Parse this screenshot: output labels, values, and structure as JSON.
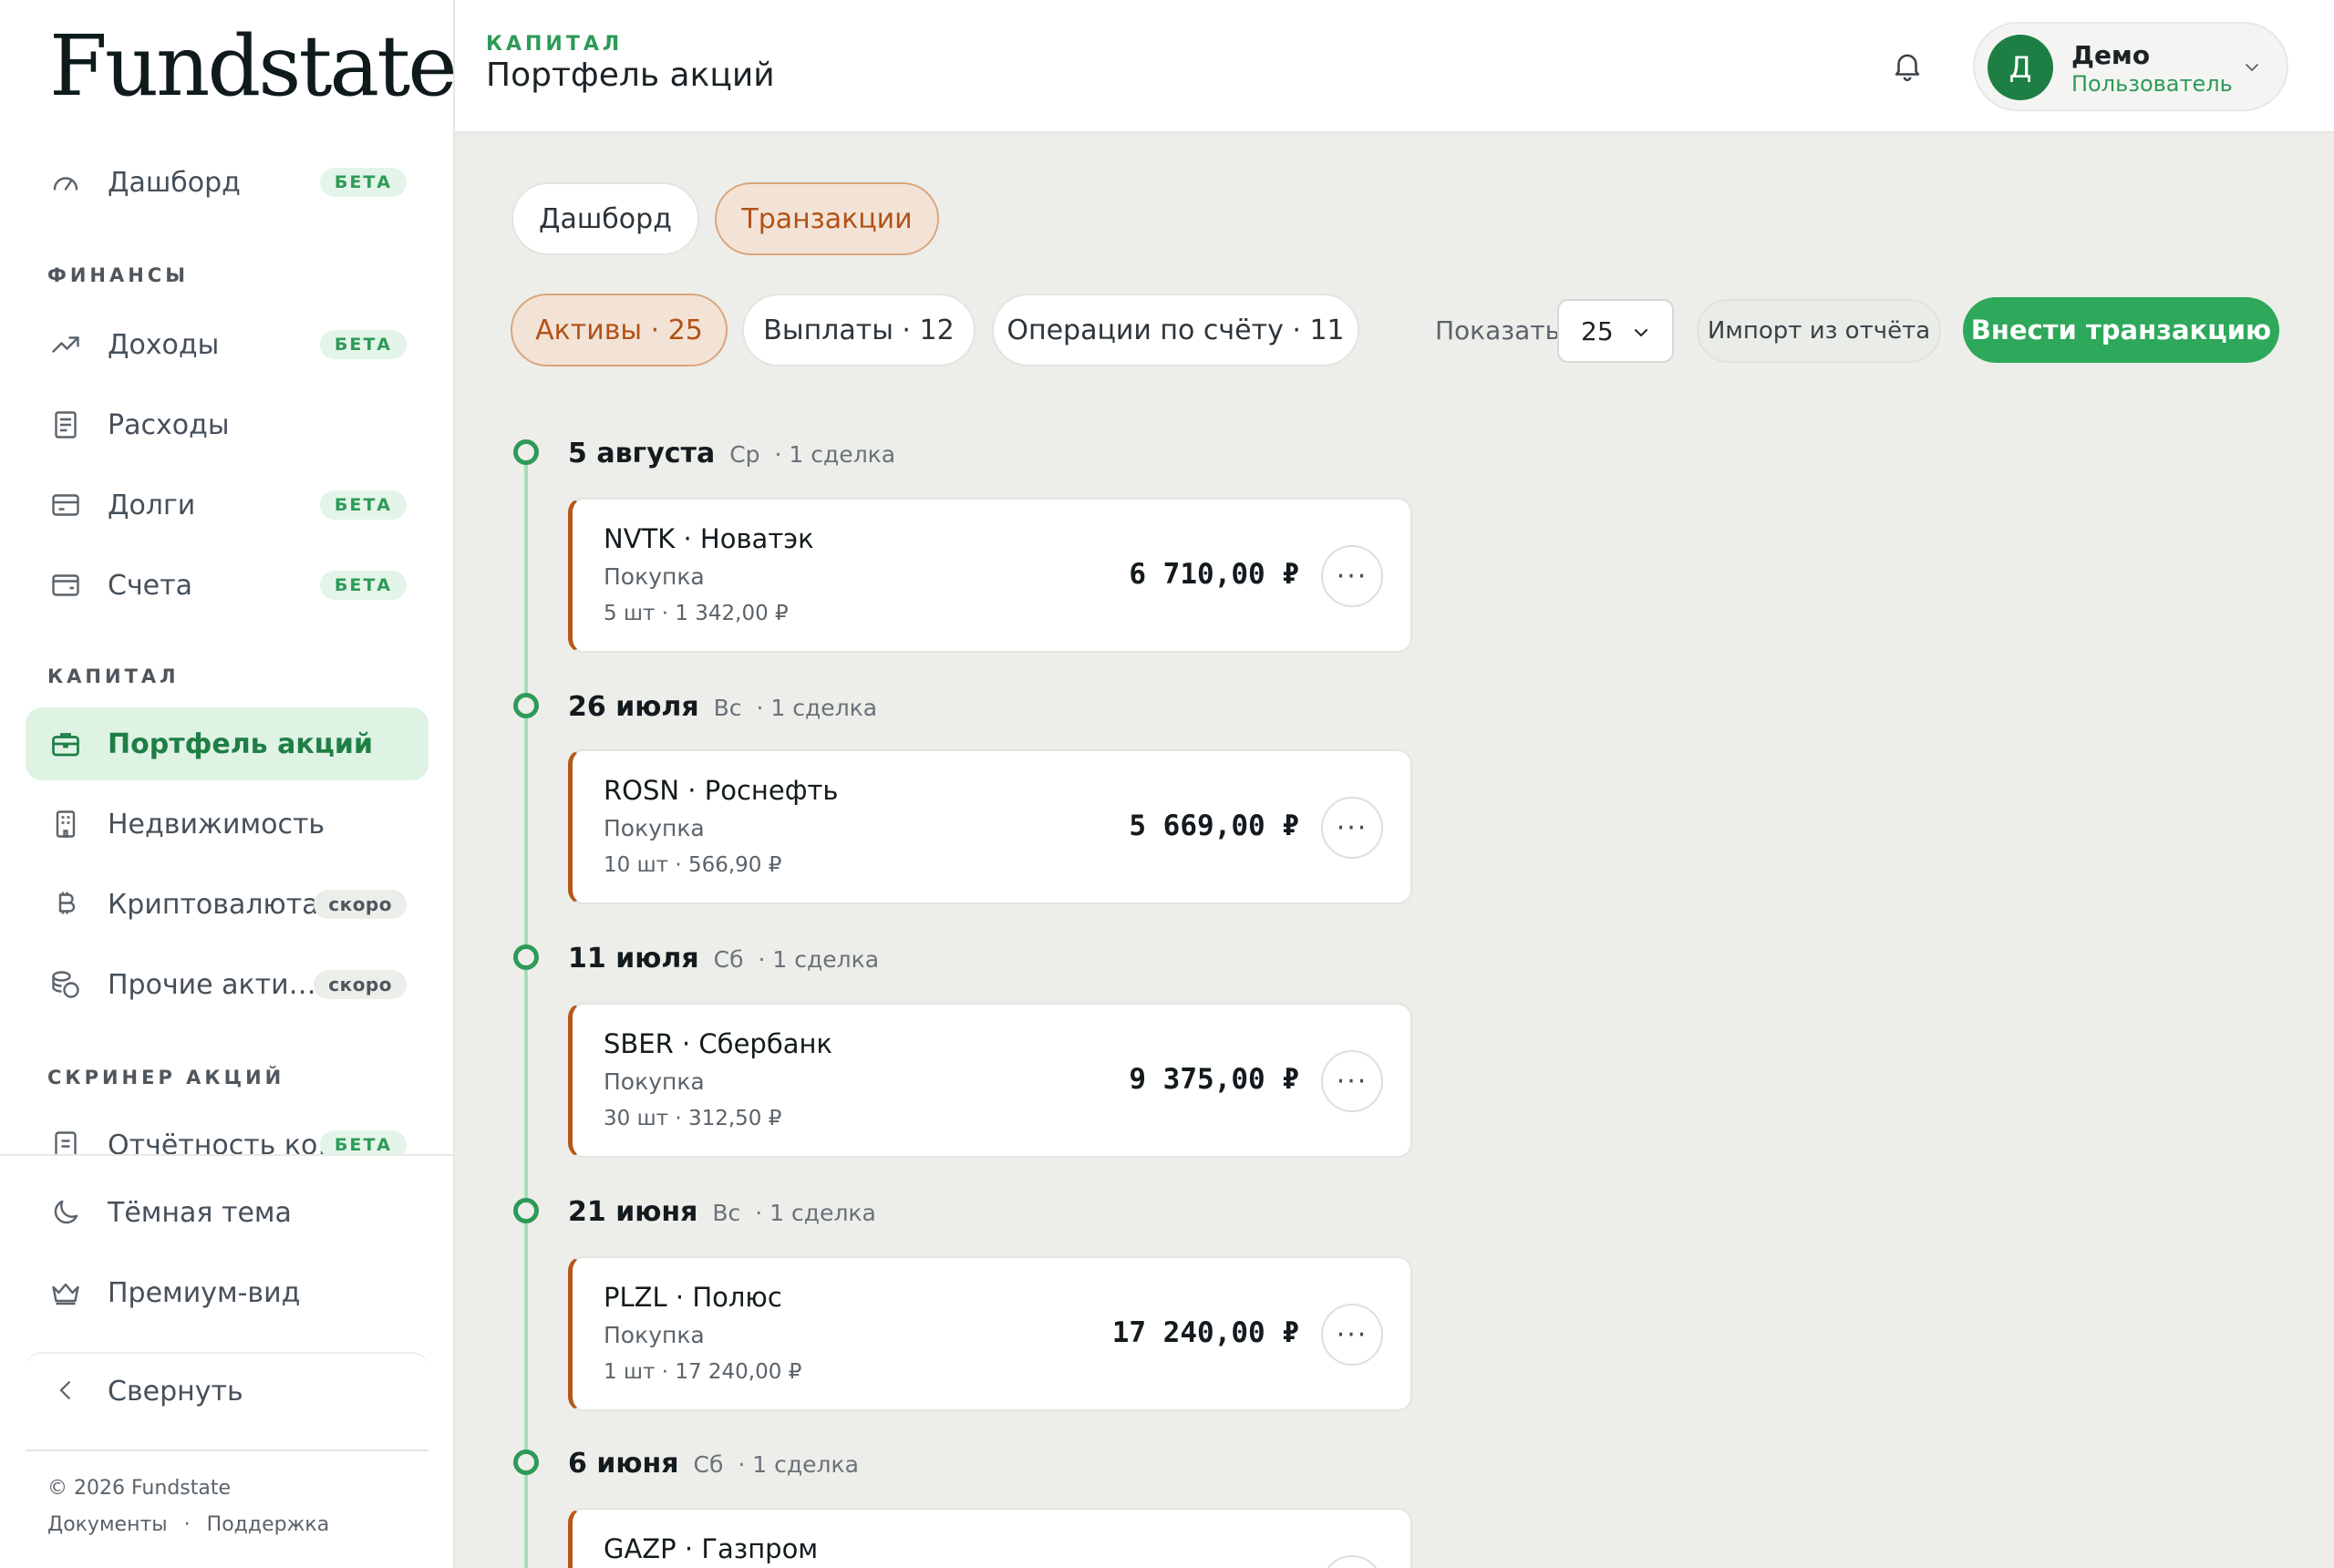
{
  "brand": {
    "logo": "Fundstate"
  },
  "sidebar": {
    "items_top": [
      {
        "label": "Дашборд",
        "badge": "БЕТА",
        "icon": "gauge-icon"
      }
    ],
    "section_finance": "ФИНАНСЫ",
    "finance_items": [
      {
        "label": "Доходы",
        "badge": "БЕТА",
        "icon": "trend-up-icon"
      },
      {
        "label": "Расходы",
        "badge": "",
        "icon": "receipt-icon"
      },
      {
        "label": "Долги",
        "badge": "БЕТА",
        "icon": "card-icon"
      },
      {
        "label": "Счета",
        "badge": "БЕТА",
        "icon": "wallet-icon"
      }
    ],
    "section_capital": "КАПИТАЛ",
    "capital_items": [
      {
        "label": "Портфель акций",
        "badge": "",
        "icon": "briefcase-icon",
        "active": true
      },
      {
        "label": "Недвижимость",
        "badge": "",
        "icon": "building-icon"
      },
      {
        "label": "Криптовалюта",
        "badge": "скоро",
        "icon": "bitcoin-icon"
      },
      {
        "label": "Прочие акти…",
        "badge": "скоро",
        "icon": "coins-icon"
      }
    ],
    "section_screener": "СКРИНЕР АКЦИЙ",
    "screener_items": [
      {
        "label": "Отчётность ко…",
        "badge": "БЕТА",
        "icon": "report-icon"
      }
    ],
    "bottom": {
      "dark_theme": "Тёмная тема",
      "premium": "Премиум-вид",
      "collapse": "Свернуть",
      "copyright": "© 2026 Fundstate",
      "docs": "Документы",
      "dot": "·",
      "support": "Поддержка"
    }
  },
  "header": {
    "crumb": "КАПИТАЛ",
    "title": "Портфель акций",
    "user": {
      "initial": "Д",
      "name": "Демо",
      "role": "Пользователь"
    }
  },
  "tabs": [
    {
      "label": "Дашборд",
      "active": false
    },
    {
      "label": "Транзакции",
      "active": true
    }
  ],
  "filters": [
    {
      "label": "Активы · 25",
      "active": true
    },
    {
      "label": "Выплаты · 12",
      "active": false
    },
    {
      "label": "Операции по счёту · 11",
      "active": false
    }
  ],
  "toolbar": {
    "show_label": "Показать",
    "page_size": "25",
    "import_label": "Импорт из отчёта",
    "add_label": "Внести транзакцию"
  },
  "timeline": [
    {
      "day": "5 августа",
      "weekday": "Ср",
      "count": "· 1 сделка",
      "deal": {
        "ticker": "NVTK · Новатэк",
        "op": "Покупка",
        "qty": "5 шт · 1 342,00 ₽",
        "sum": "6 710,00 ₽"
      }
    },
    {
      "day": "26 июля",
      "weekday": "Вс",
      "count": "· 1 сделка",
      "deal": {
        "ticker": "ROSN · Роснефть",
        "op": "Покупка",
        "qty": "10 шт · 566,90 ₽",
        "sum": "5 669,00 ₽"
      }
    },
    {
      "day": "11 июля",
      "weekday": "Сб",
      "count": "· 1 сделка",
      "deal": {
        "ticker": "SBER · Сбербанк",
        "op": "Покупка",
        "qty": "30 шт · 312,50 ₽",
        "sum": "9 375,00 ₽"
      }
    },
    {
      "day": "21 июня",
      "weekday": "Вс",
      "count": "· 1 сделка",
      "deal": {
        "ticker": "PLZL · Полюс",
        "op": "Покупка",
        "qty": "1 шт · 17 240,00 ₽",
        "sum": "17 240,00 ₽"
      }
    },
    {
      "day": "6 июня",
      "weekday": "Сб",
      "count": "· 1 сделка",
      "deal": {
        "ticker": "GAZP · Газпром",
        "op": "",
        "qty": "",
        "sum": ""
      }
    }
  ],
  "more_glyph": "···",
  "colors": {
    "accent_green": "#2ea85a",
    "accent_orange": "#b6581a",
    "active_bg": "#dff3e5"
  }
}
